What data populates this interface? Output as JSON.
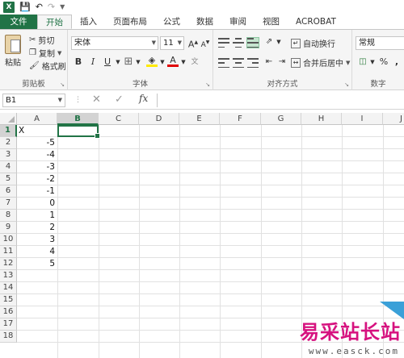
{
  "qat": {
    "logo": "X",
    "save_icon": "save-icon",
    "undo_icon": "undo-icon",
    "redo_icon": "redo-icon"
  },
  "tabs": [
    "文件",
    "开始",
    "插入",
    "页面布局",
    "公式",
    "数据",
    "审阅",
    "视图",
    "ACROBAT"
  ],
  "active_tab": "开始",
  "ribbon": {
    "clipboard": {
      "paste": "粘贴",
      "cut": "剪切",
      "copy": "复制",
      "format_painter": "格式刷",
      "label": "剪贴板"
    },
    "font": {
      "font_name": "宋体",
      "font_size": "11",
      "grow": "A",
      "shrink": "A",
      "bold": "B",
      "italic": "I",
      "underline": "U",
      "font_color_letter": "A",
      "label": "字体"
    },
    "alignment": {
      "wrap_text": "自动换行",
      "merge_center": "合并后居中",
      "label": "对齐方式"
    },
    "number": {
      "format": "常规",
      "percent": "%",
      "comma": ",",
      "label": "数字"
    }
  },
  "formula_bar": {
    "name_box": "B1",
    "cancel": "✕",
    "enter": "✓",
    "fx": "fx",
    "value": ""
  },
  "grid": {
    "columns": [
      "A",
      "B",
      "C",
      "D",
      "E",
      "F",
      "G",
      "H",
      "I",
      "J"
    ],
    "rows": [
      "1",
      "2",
      "3",
      "4",
      "5",
      "6",
      "7",
      "8",
      "9",
      "10",
      "11",
      "12",
      "13",
      "14",
      "15",
      "16",
      "17",
      "18"
    ],
    "selected_cell": "B1",
    "a1_value": "X",
    "column_a_values": [
      "-5",
      "-4",
      "-3",
      "-2",
      "-1",
      "0",
      "1",
      "2",
      "3",
      "4",
      "5"
    ]
  },
  "watermark": {
    "text": "易采站长站",
    "url": "www.easck.com"
  },
  "colors": {
    "accent": "#217346",
    "watermark": "#d6127f"
  }
}
